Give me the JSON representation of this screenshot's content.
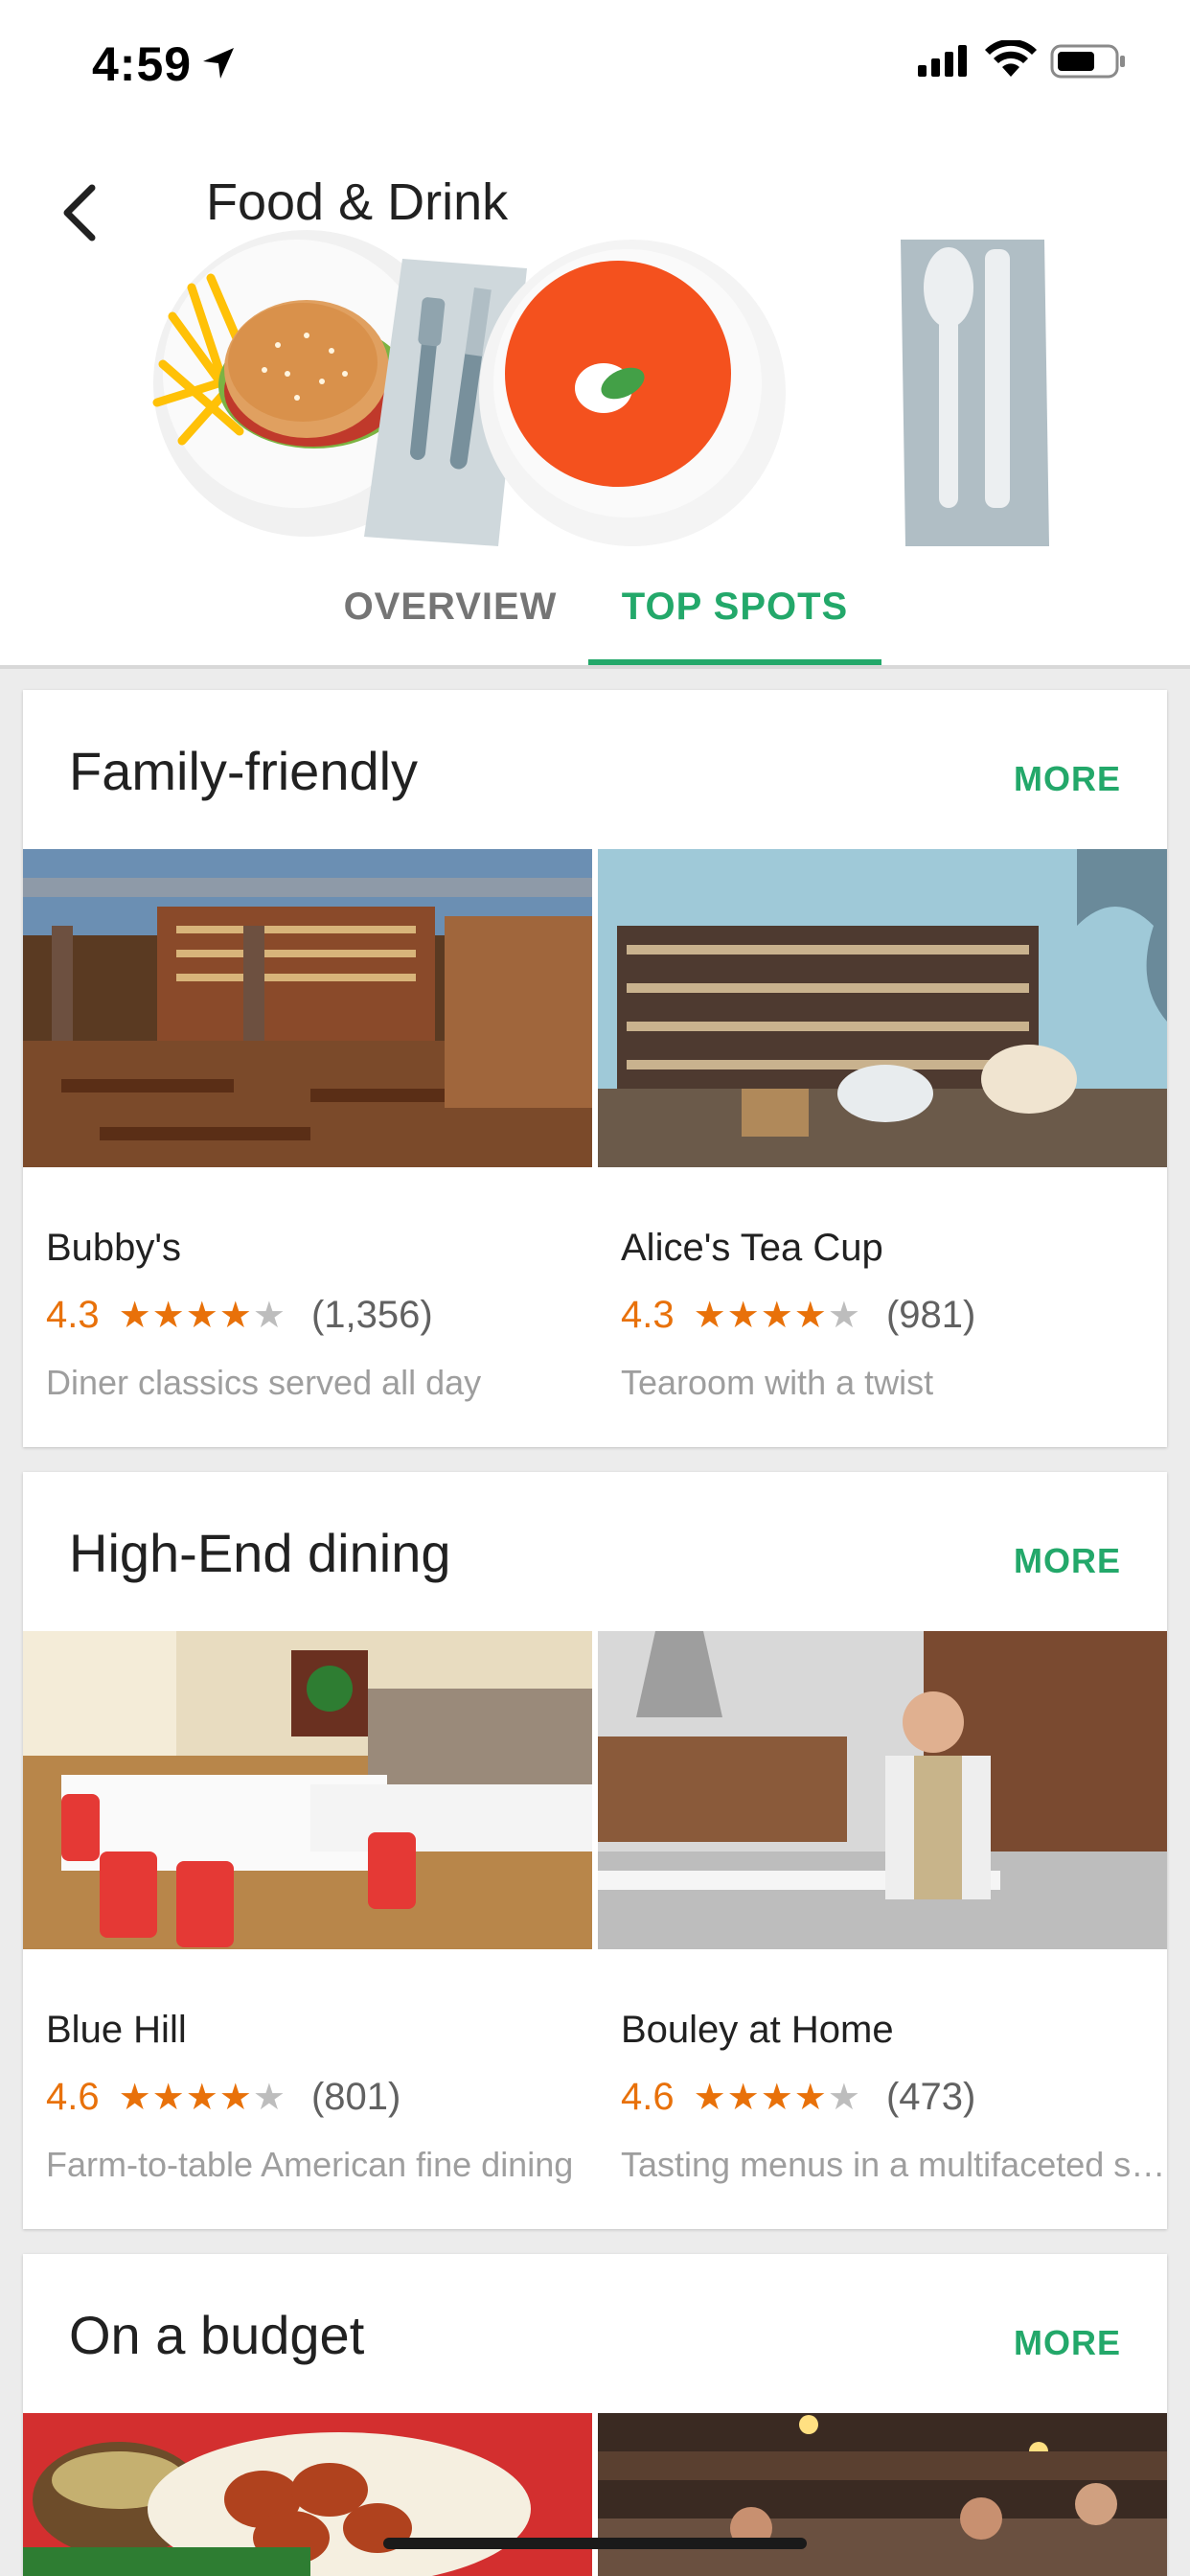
{
  "status": {
    "time": "4:59"
  },
  "header": {
    "title": "Food & Drink",
    "tabs": [
      {
        "label": "OVERVIEW",
        "selected": false
      },
      {
        "label": "TOP SPOTS",
        "selected": true
      }
    ]
  },
  "colors": {
    "accent": "#23a86a",
    "rating": "#e8710a"
  },
  "sections": [
    {
      "title": "Family-friendly",
      "more": "MORE",
      "places": [
        {
          "name": "Bubby's",
          "rating": "4.3",
          "stars": "★★★★",
          "count": "(1,356)",
          "desc": "Diner classics served all day"
        },
        {
          "name": "Alice's Tea Cup",
          "rating": "4.3",
          "stars": "★★★★",
          "count": "(981)",
          "desc": "Tearoom with a twist"
        }
      ]
    },
    {
      "title": "High-End dining",
      "more": "MORE",
      "places": [
        {
          "name": "Blue Hill",
          "rating": "4.6",
          "stars": "★★★★",
          "count": "(801)",
          "desc": "Farm-to-table American fine dining"
        },
        {
          "name": "Bouley at Home",
          "rating": "4.6",
          "stars": "★★★★",
          "count": "(473)",
          "desc": "Tasting menus in a multifaceted space"
        }
      ]
    },
    {
      "title": "On a budget",
      "more": "MORE"
    }
  ]
}
